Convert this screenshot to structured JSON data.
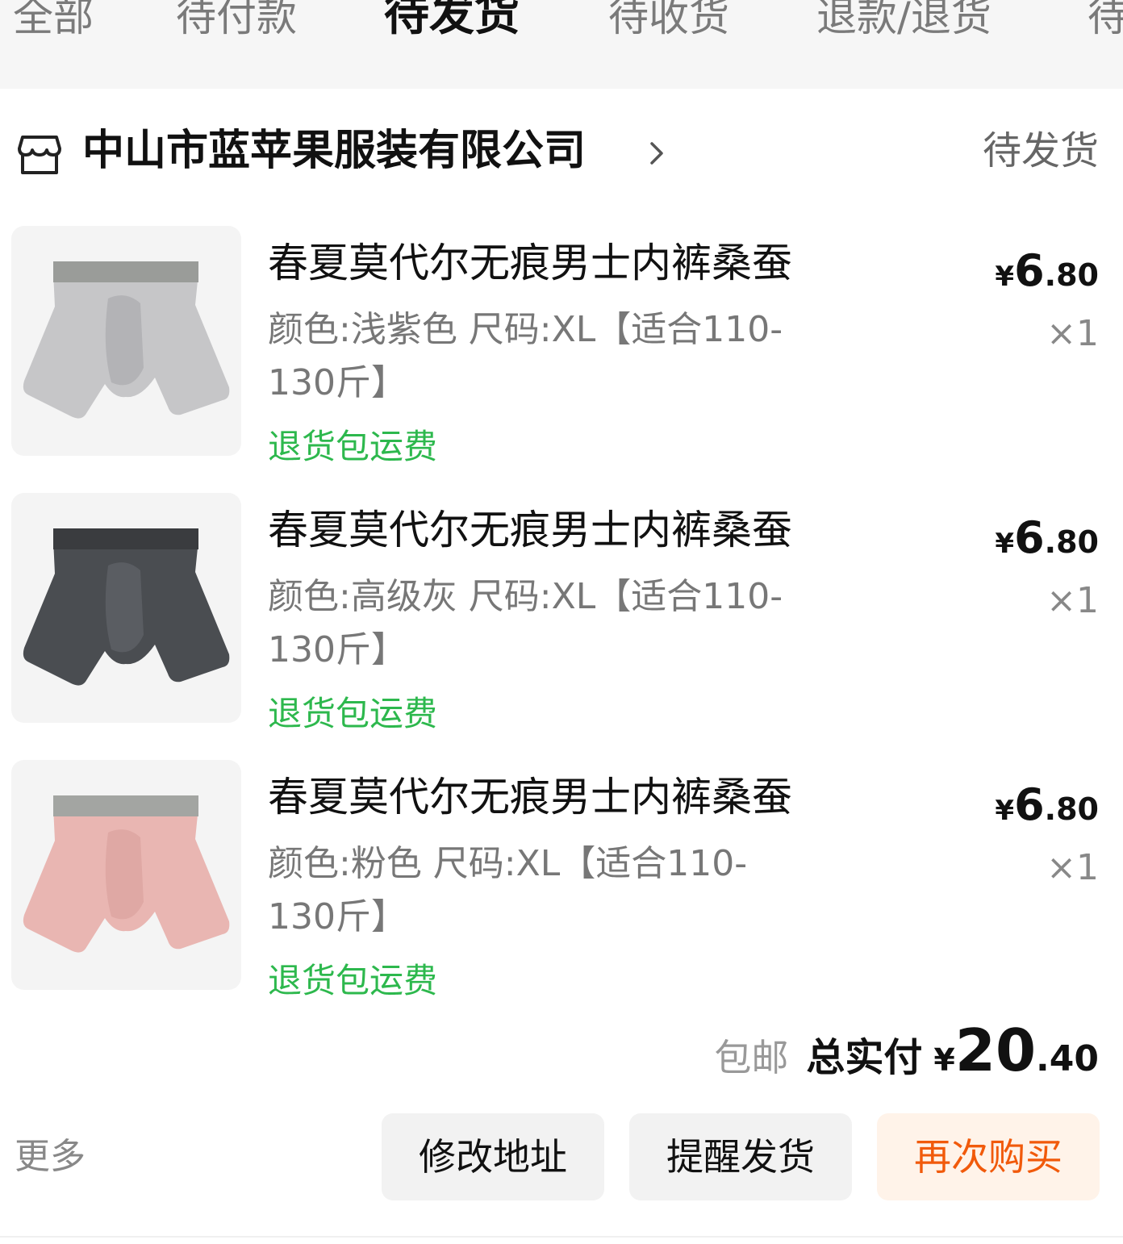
{
  "tabs": [
    {
      "label": "全部"
    },
    {
      "label": "待付款"
    },
    {
      "label": "待发货"
    },
    {
      "label": "待收货"
    },
    {
      "label": "退款/退货"
    },
    {
      "label": "待"
    }
  ],
  "active_tab": "待发货",
  "shop": {
    "name": "中山市蓝苹果服装有限公司",
    "status": "待发货"
  },
  "items": [
    {
      "title": "春夏莫代尔无痕男士内裤桑蚕",
      "spec": "颜色:浅紫色 尺码:XL【适合110-130斤】",
      "promo": "退货包运费",
      "price_currency": "¥",
      "price_int": "6",
      "price_dec": ".80",
      "qty": "×1",
      "color": "#c6c6c8"
    },
    {
      "title": "春夏莫代尔无痕男士内裤桑蚕",
      "spec": "颜色:高级灰 尺码:XL【适合110-130斤】",
      "promo": "退货包运费",
      "price_currency": "¥",
      "price_int": "6",
      "price_dec": ".80",
      "qty": "×1",
      "color": "#4a4d51"
    },
    {
      "title": "春夏莫代尔无痕男士内裤桑蚕",
      "spec": "颜色:粉色 尺码:XL【适合110-130斤】",
      "promo": "退货包运费",
      "price_currency": "¥",
      "price_int": "6",
      "price_dec": ".80",
      "qty": "×1",
      "color": "#e9b6b2"
    }
  ],
  "summary": {
    "free_shipping": "包邮",
    "total_label": "总实付",
    "total_currency": "¥",
    "total_int": "20",
    "total_dec": ".40"
  },
  "actions": {
    "more": "更多",
    "modify_address": "修改地址",
    "remind_ship": "提醒发货",
    "buy_again": "再次购买"
  }
}
